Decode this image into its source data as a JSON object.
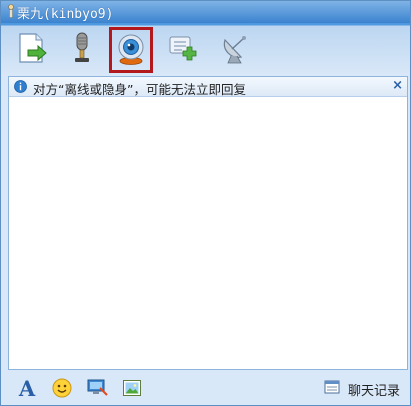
{
  "window": {
    "title": "栗九(kinbyo9)",
    "title_icon": "contact-icon"
  },
  "toolbar": {
    "items": [
      {
        "name": "send-file",
        "icon": "file-send-icon"
      },
      {
        "name": "voice",
        "icon": "microphone-icon"
      },
      {
        "name": "video",
        "icon": "webcam-icon",
        "selected": true
      },
      {
        "name": "add-note",
        "icon": "message-add-icon"
      },
      {
        "name": "remote",
        "icon": "satellite-dish-icon"
      }
    ]
  },
  "notice": {
    "text": "对方“离线或隐身”，可能无法立即回复",
    "close_label": "×",
    "icon": "info-icon"
  },
  "bottombar": {
    "items": [
      {
        "name": "font",
        "icon": "font-icon",
        "label": "A"
      },
      {
        "name": "emoji",
        "icon": "smiley-icon"
      },
      {
        "name": "screen",
        "icon": "screen-capture-icon"
      },
      {
        "name": "image",
        "icon": "image-icon"
      }
    ],
    "history_label": "聊天记录",
    "history_icon": "history-window-icon"
  },
  "colors": {
    "title_bg": "#3b83cf",
    "selection_border": "#b3181d",
    "window_bg": "#d9e8f8"
  }
}
